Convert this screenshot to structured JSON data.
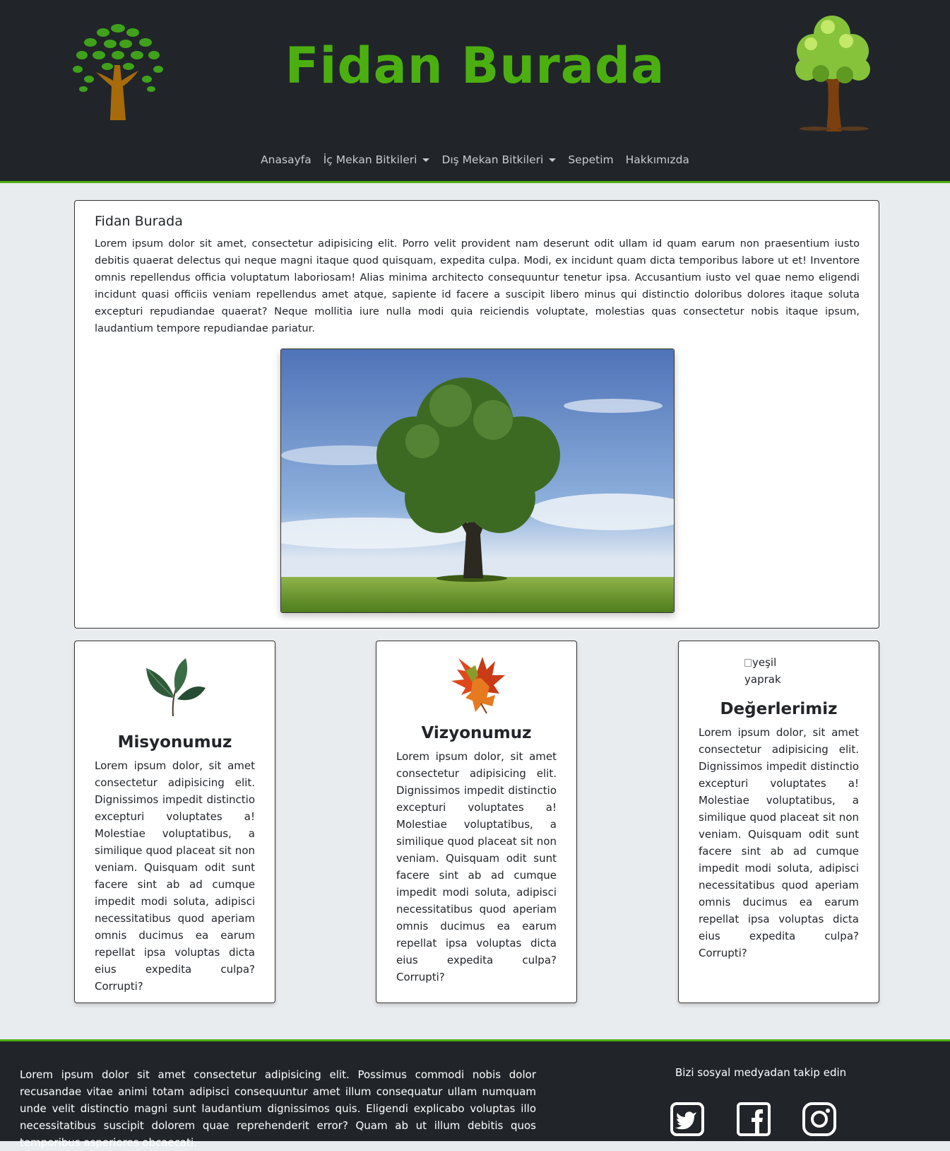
{
  "header": {
    "title": "Fidan Burada",
    "nav": [
      {
        "label": "Anasayfa",
        "dropdown": false
      },
      {
        "label": "İç Mekan Bitkileri",
        "dropdown": true
      },
      {
        "label": "Dış Mekan Bitkileri",
        "dropdown": true
      },
      {
        "label": "Sepetim",
        "dropdown": false
      },
      {
        "label": "Hakkımızda",
        "dropdown": false
      }
    ]
  },
  "main": {
    "heading": "Fidan Burada",
    "text": "Lorem ipsum dolor sit amet, consectetur adipisicing elit. Porro velit provident nam deserunt odit ullam id quam earum non praesentium iusto debitis quaerat delectus qui neque magni itaque quod quisquam, expedita culpa. Modi, ex incidunt quam dicta temporibus labore ut et! Inventore omnis repellendus officia voluptatum laboriosam! Alias minima architecto consequuntur tenetur ipsa. Accusantium iusto vel quae nemo eligendi incidunt quasi officiis veniam repellendus amet atque, sapiente id facere a suscipit libero minus qui distinctio doloribus dolores itaque soluta excepturi repudiandae quaerat? Neque mollitia iure nulla modi quia reiciendis voluptate, molestias quas consectetur nobis itaque ipsum, laudantium tempore repudiandae pariatur."
  },
  "cards": [
    {
      "title": "Misyonumuz",
      "text": "Lorem ipsum dolor, sit amet consectetur adipisicing elit. Dignissimos impedit distinctio excepturi voluptates a! Molestiae voluptatibus, a similique quod placeat sit non veniam. Quisquam odit sunt facere sint ab ad cumque impedit modi soluta, adipisci necessitatibus quod aperiam omnis ducimus ea earum repellat ipsa voluptas dicta eius expedita culpa? Corrupti?"
    },
    {
      "title": "Vizyonumuz",
      "text": "Lorem ipsum dolor, sit amet consectetur adipisicing elit. Dignissimos impedit distinctio excepturi voluptates a! Molestiae voluptatibus, a similique quod placeat sit non veniam. Quisquam odit sunt facere sint ab ad cumque impedit modi soluta, adipisci necessitatibus quod aperiam omnis ducimus ea earum repellat ipsa voluptas dicta eius expedita culpa? Corrupti?"
    },
    {
      "title": "Değerlerimiz",
      "image_alt": "yeşil yaprak",
      "text": "Lorem ipsum dolor, sit amet consectetur adipisicing elit. Dignissimos impedit distinctio excepturi voluptates a! Molestiae voluptatibus, a similique quod placeat sit non veniam. Quisquam odit sunt facere sint ab ad cumque impedit modi soluta, adipisci necessitatibus quod aperiam omnis ducimus ea earum repellat ipsa voluptas dicta eius expedita culpa? Corrupti?"
    }
  ],
  "footer": {
    "text": "Lorem ipsum dolor sit amet consectetur adipisicing elit. Possimus commodi nobis dolor recusandae vitae animi totam adipisci consequuntur amet illum consequatur ullam numquam unde velit distinctio magni sunt laudantium dignissimos quis. Eligendi explicabo voluptas illo necessitatibus suscipit dolorem quae reprehenderit error? Quam ab ut illum debitis quos temporibus asperiores obcaecati.",
    "social_title": "Bizi sosyal medyadan takip edin",
    "social_icons": [
      "twitter-icon",
      "facebook-icon",
      "instagram-icon"
    ]
  },
  "colors": {
    "accent": "#4caf10",
    "dark": "#212529",
    "page_bg": "#e9ecef"
  }
}
